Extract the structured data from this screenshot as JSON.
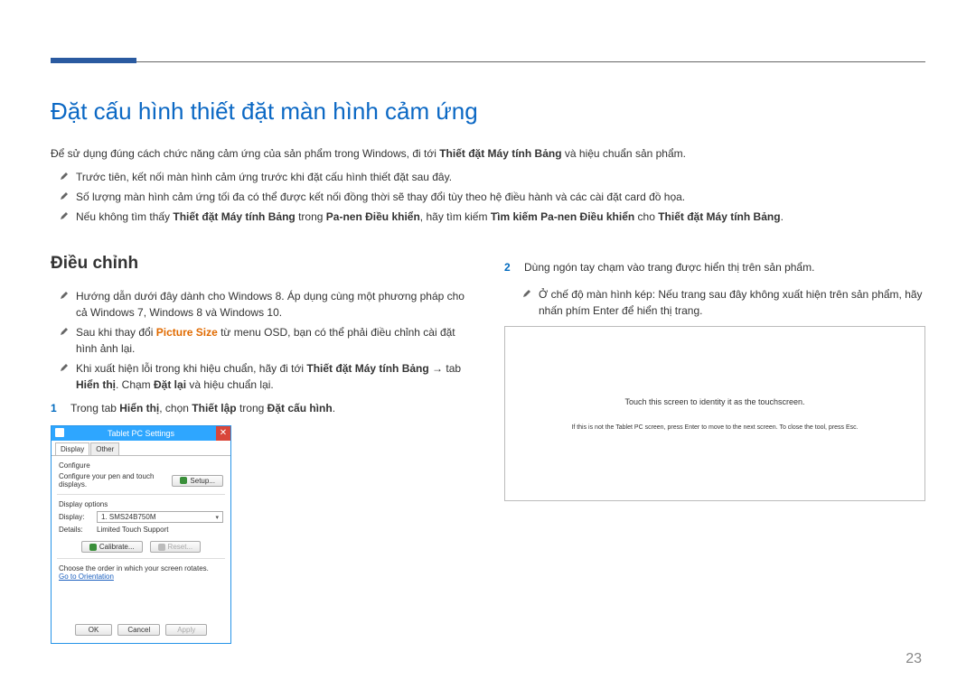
{
  "page_number": "23",
  "h1": "Đặt cấu hình thiết đặt màn hình cảm ứng",
  "intro_pre": "Để sử dụng đúng cách chức năng cảm ứng của sản phẩm trong Windows, đi tới ",
  "intro_bold": "Thiết đặt Máy tính Bảng",
  "intro_post": " và hiệu chuẩn sản phẩm.",
  "notes_top": {
    "n1": "Trước tiên, kết nối màn hình cảm ứng trước khi đặt cấu hình thiết đặt sau đây.",
    "n2": "Số lượng màn hình cảm ứng tối đa có thể được kết nối đồng thời sẽ thay đổi tùy theo hệ điều hành và các cài đặt card đồ họa.",
    "n3_pre": "Nếu không tìm thấy ",
    "n3_b1": "Thiết đặt Máy tính Bảng",
    "n3_mid1": " trong ",
    "n3_b2": "Pa-nen Điều khiển",
    "n3_mid2": ", hãy tìm kiếm ",
    "n3_b3": "Tìm kiếm Pa-nen Điều khiển",
    "n3_mid3": " cho ",
    "n3_b4": "Thiết đặt Máy tính Bảng",
    "n3_end": "."
  },
  "left": {
    "h2": "Điều chỉnh",
    "ln1": "Hướng dẫn dưới đây dành cho Windows 8. Áp dụng cùng một phương pháp cho cả Windows 7, Windows 8 và Windows 10.",
    "ln2_pre": "Sau khi thay đổi ",
    "ln2_orange": "Picture Size",
    "ln2_post": " từ menu OSD, bạn có thể phải điều chỉnh cài đặt hình ảnh lại.",
    "ln3_pre": "Khi xuất hiện lỗi trong khi hiệu chuẩn, hãy đi tới ",
    "ln3_b1": "Thiết đặt Máy tính Bảng",
    "ln3_mid1": " → tab ",
    "ln3_b2": "Hiển thị",
    "ln3_mid2": ". Chạm ",
    "ln3_b3": "Đặt lại",
    "ln3_end": " và hiệu chuẩn lại.",
    "step1_pre": "Trong tab ",
    "step1_b1": "Hiển thị",
    "step1_mid1": ", chọn ",
    "step1_b2": "Thiết lập",
    "step1_mid2": " trong ",
    "step1_b3": "Đặt cấu hình",
    "step1_end": "."
  },
  "dlg": {
    "title": "Tablet PC Settings",
    "close": "✕",
    "tab_display": "Display",
    "tab_other": "Other",
    "configure": "Configure",
    "configure_desc": "Configure your pen and touch displays.",
    "setup_btn": "Setup...",
    "display_options": "Display options",
    "display_label": "Display:",
    "display_value": "1. SMS24B750M",
    "details_label": "Details:",
    "details_value": "Limited Touch Support",
    "calibrate_btn": "Calibrate...",
    "reset_btn": "Reset...",
    "rotate_text": "Choose the order in which your screen rotates.",
    "goto_link": "Go to Orientation",
    "ok": "OK",
    "cancel": "Cancel",
    "apply": "Apply"
  },
  "right": {
    "step2": "Dùng ngón tay chạm vào trang được hiển thị trên sản phẩm.",
    "rn_pre": "Ở chế độ màn hình kép: Nếu trang sau đây không xuất hiện trên sản phẩm, hãy nhấn phím Enter để hiển thị trang.",
    "calib_l1": "Touch this screen to identity it as the touchscreen.",
    "calib_l2": "If this is not the Tablet PC screen, press Enter to move to the next screen. To close the tool, press Esc."
  }
}
